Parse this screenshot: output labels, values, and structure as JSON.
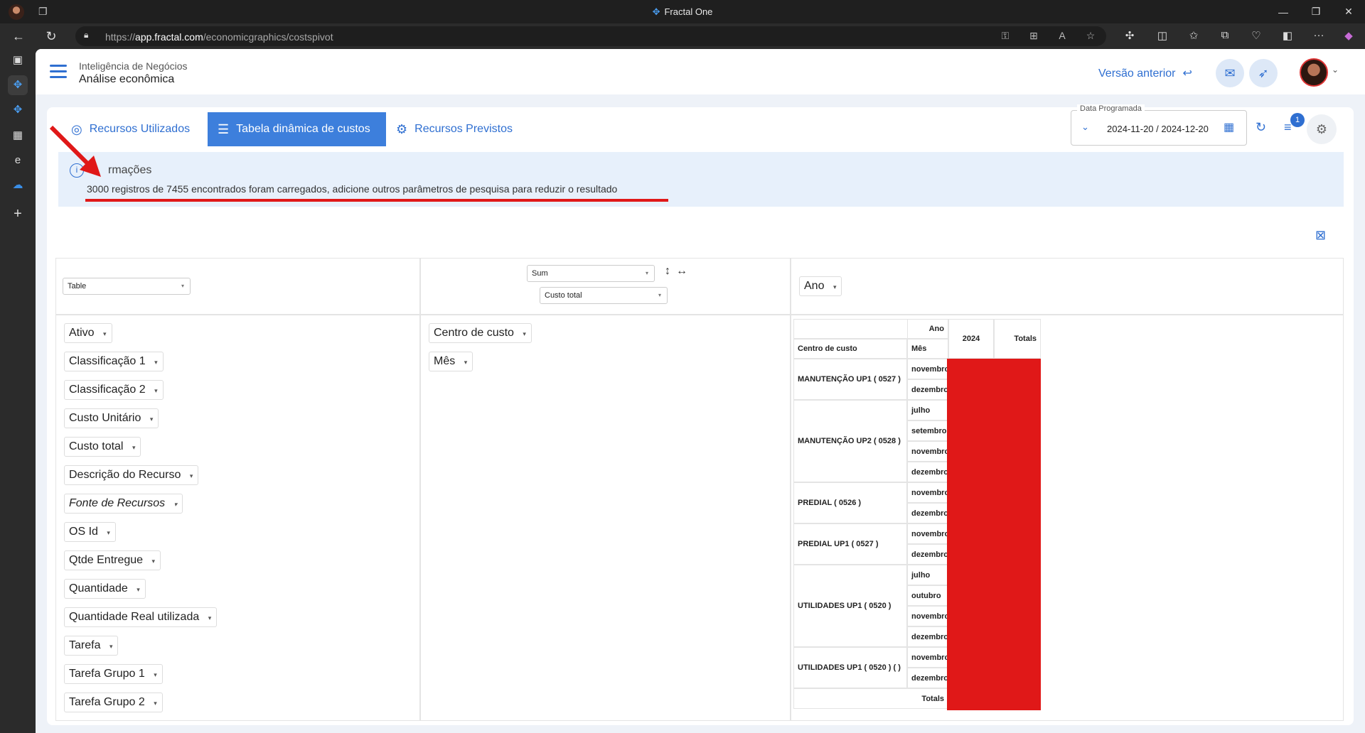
{
  "window": {
    "title": "Fractal One"
  },
  "browser": {
    "url_scheme": "https://",
    "url_host": "app.fractal.com",
    "url_path": "/economicgraphics/costspivot"
  },
  "header": {
    "breadcrumb_top": "Inteligência de Negócios",
    "breadcrumb_bottom": "Análise econômica",
    "prev_version_label": "Versão anterior"
  },
  "tabs": [
    {
      "label": "Recursos Utilizados",
      "icon": "check-circle-icon"
    },
    {
      "label": "Tabela dinâmica de custos",
      "icon": "table-icon",
      "active": true
    },
    {
      "label": "Recursos Previstos",
      "icon": "gear-icon"
    }
  ],
  "filters": {
    "date_label": "Data Programada",
    "date_value": "2024-11-20 / 2024-12-20",
    "filter_count": "1"
  },
  "info": {
    "title_fragment": "rmações",
    "message": "3000 registros de 7455 encontrados foram carregados, adicione outros parâmetros de pesquisa para reduzir o resultado"
  },
  "pivot": {
    "renderer": "Table",
    "aggregator": "Sum",
    "value_field": "Custo total",
    "col_field": "Ano",
    "unused_fields": [
      "Ativo",
      "Classificação 1",
      "Classificação 2",
      "Custo Unitário",
      "Custo total",
      "Descrição do Recurso",
      "Fonte de Recursos",
      "OS Id",
      "Qtde Entregue",
      "Quantidade",
      "Quantidade Real utilizada",
      "Tarefa",
      "Tarefa Grupo 1",
      "Tarefa Grupo 2"
    ],
    "row_fields": [
      "Centro de custo",
      "Mês"
    ],
    "table": {
      "col_attr_label": "Ano",
      "row_header_1": "Centro de custo",
      "row_header_2": "Mês",
      "year": "2024",
      "totals_label": "Totals",
      "grand_total_label": "Totals",
      "groups": [
        {
          "name": "MANUTENÇÃO UP1 ( 0527 )",
          "months": [
            "novembro",
            "dezembro"
          ]
        },
        {
          "name": "MANUTENÇÃO UP2 ( 0528 )",
          "months": [
            "julho",
            "setembro",
            "novembro",
            "dezembro"
          ]
        },
        {
          "name": "PREDIAL ( 0526 )",
          "months": [
            "novembro",
            "dezembro"
          ]
        },
        {
          "name": "PREDIAL UP1 ( 0527 )",
          "months": [
            "novembro",
            "dezembro"
          ]
        },
        {
          "name": "UTILIDADES UP1 ( 0520 )",
          "months": [
            "julho",
            "outubro",
            "novembro",
            "dezembro"
          ]
        },
        {
          "name": "UTILIDADES UP1 ( 0520 ) ( )",
          "months": [
            "novembro",
            "dezembro"
          ]
        }
      ]
    }
  },
  "colors": {
    "accent": "#2f6fd1",
    "active_tab": "#3d7fdc",
    "annotation_red": "#e01818"
  }
}
